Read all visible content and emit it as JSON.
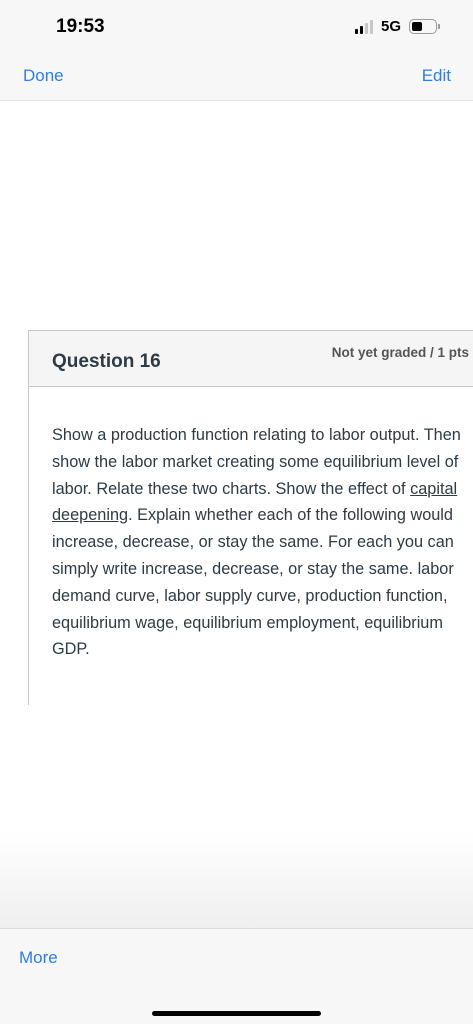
{
  "status_bar": {
    "time": "19:53",
    "network": "5G",
    "signal_bars_active": 2,
    "signal_bars_total": 4,
    "battery_fraction": 0.45
  },
  "nav": {
    "left_label": "Done",
    "right_label": "Edit"
  },
  "question": {
    "title": "Question 16",
    "status": "Not yet graded / 1 pts",
    "text_before_link": "Show a production function relating to labor output. Then show the labor market creating some equilibrium level of labor. Relate these two charts. Show the effect of ",
    "link_text": "capital deepening",
    "text_after_link": ". Explain whether each of the following would increase, decrease, or stay the same. For each you can simply write increase, decrease, or stay the same. labor demand curve, labor supply curve, production function, equilibrium wage, equilibrium employment, equilibrium GDP."
  },
  "bottom_bar": {
    "more_label": "More"
  },
  "colors": {
    "link_blue": "#2f7de1",
    "text_dark": "#2d3b45",
    "header_bg": "#f5f5f5"
  }
}
